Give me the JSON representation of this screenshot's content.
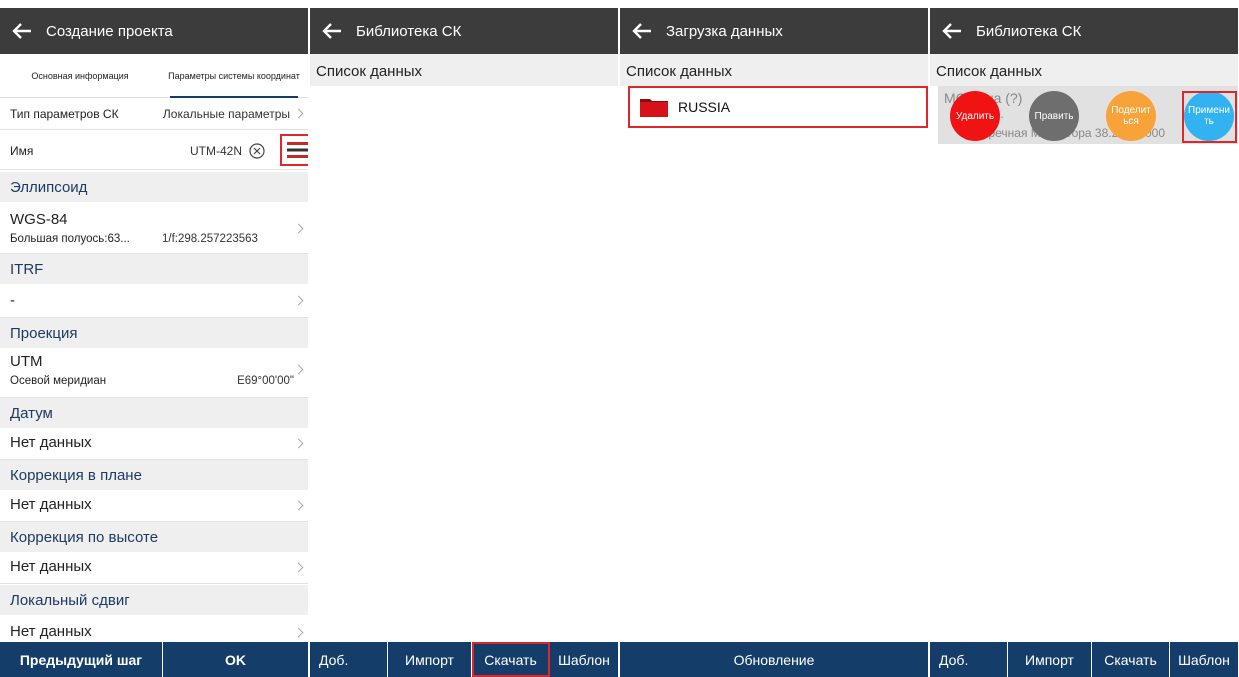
{
  "colors": {
    "header": "#3c3c3c",
    "footer": "#143d6a",
    "highlight": "#e0262d",
    "section_bg": "#efefef",
    "section_text": "#1d3b62"
  },
  "panel1": {
    "title": "Создание проекта",
    "tabs": [
      "Основная информация",
      "Параметры системы координат"
    ],
    "type_row": {
      "label": "Тип параметров СК",
      "value": "Локальные параметры"
    },
    "name_row": {
      "label": "Имя",
      "value": "UTM-42N"
    },
    "ellipsoid": {
      "section": "Эллипсоид",
      "name": "WGS-84",
      "detail1": "Большая полуось:63...",
      "detail2": "1/f:298.257223563"
    },
    "itrf": {
      "section": "ITRF",
      "value": "-"
    },
    "projection": {
      "section": "Проекция",
      "name": "UTM",
      "detail_label": "Осевой меридиан",
      "detail_value": "E69°00'00\""
    },
    "datum": {
      "section": "Датум",
      "value": "Нет данных"
    },
    "plane_corr": {
      "section": "Коррекция в плане",
      "value": "Нет данных"
    },
    "height_corr": {
      "section": "Коррекция по высоте",
      "value": "Нет данных"
    },
    "local_shift": {
      "section": "Локальный сдвиг",
      "value": "Нет данных"
    },
    "footer": [
      "Предыдущий шаг",
      "OK"
    ]
  },
  "panel2": {
    "title": "Библиотека СК",
    "list_title": "Список данных",
    "footer": [
      "Доб.",
      "Импорт",
      "Скачать",
      "Шаблон"
    ]
  },
  "panel3": {
    "title": "Загрузка данных",
    "list_title": "Список данных",
    "folder": "RUSSIA",
    "footer": [
      "Обновление"
    ]
  },
  "panel4": {
    "title": "Библиотека СК",
    "list_title": "Список данных",
    "item_line1": "MC     Зона  (?)",
    "item_line2": "ате.",
    "item_line3": "Поперечная Меркатора 38.29000000",
    "actions": [
      "Удалить",
      "Править",
      "Поделиться",
      "Применить"
    ],
    "action_labels_shown": [
      "Удалить",
      "Править",
      "Поделит ься",
      "Примени ть"
    ],
    "footer": [
      "Доб.",
      "Импорт",
      "Скачать",
      "Шаблон"
    ]
  }
}
